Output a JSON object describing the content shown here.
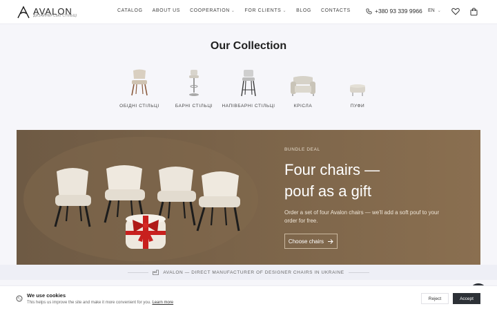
{
  "header": {
    "logo_name": "AVALON",
    "logo_sub": "ДИЗАЙНЕРСЬКІ СТІЛЬЦІ",
    "nav": [
      {
        "label": "CATALOG",
        "has_dropdown": false
      },
      {
        "label": "ABOUT US",
        "has_dropdown": false
      },
      {
        "label": "COOPERATION",
        "has_dropdown": true
      },
      {
        "label": "FOR CLIENTS",
        "has_dropdown": true
      },
      {
        "label": "BLOG",
        "has_dropdown": false
      },
      {
        "label": "CONTACTS",
        "has_dropdown": false
      }
    ],
    "phone": "+380 93 339 9966",
    "language": "EN",
    "icons": [
      "phone-icon",
      "chevron-down-icon",
      "heart-icon",
      "bag-icon"
    ]
  },
  "collection": {
    "title": "Our Collection",
    "categories": [
      {
        "label": "ОБІДНІ СТІЛЬЦІ",
        "icon": "dining-chair"
      },
      {
        "label": "БАРНІ СТІЛЬЦІ",
        "icon": "bar-stool"
      },
      {
        "label": "НАПІВБАРНІ СТІЛЬЦІ",
        "icon": "counter-stool"
      },
      {
        "label": "КРІСЛА",
        "icon": "armchair"
      },
      {
        "label": "ПУФИ",
        "icon": "pouf"
      }
    ]
  },
  "banner": {
    "eyebrow": "BUNDLE DEAL",
    "headline_line1": "Four chairs —",
    "headline_line2": "pouf as a gift",
    "description": "Order a set of four Avalon chairs — we'll add a soft pouf to your order for free.",
    "cta_label": "Choose chairs",
    "colors": {
      "background": "#7a6349",
      "ribbon": "#c8201e",
      "upholstery": "#ece6dc"
    }
  },
  "strip": {
    "text": "AVALON — DIRECT MANUFACTURER OF DESIGNER CHAIRS IN UKRAINE"
  },
  "cookie": {
    "title": "We use cookies",
    "text": "This helps us improve the site and make it more convenient for you.",
    "link": "Learn more",
    "reject": "Reject",
    "accept": "Accept"
  }
}
